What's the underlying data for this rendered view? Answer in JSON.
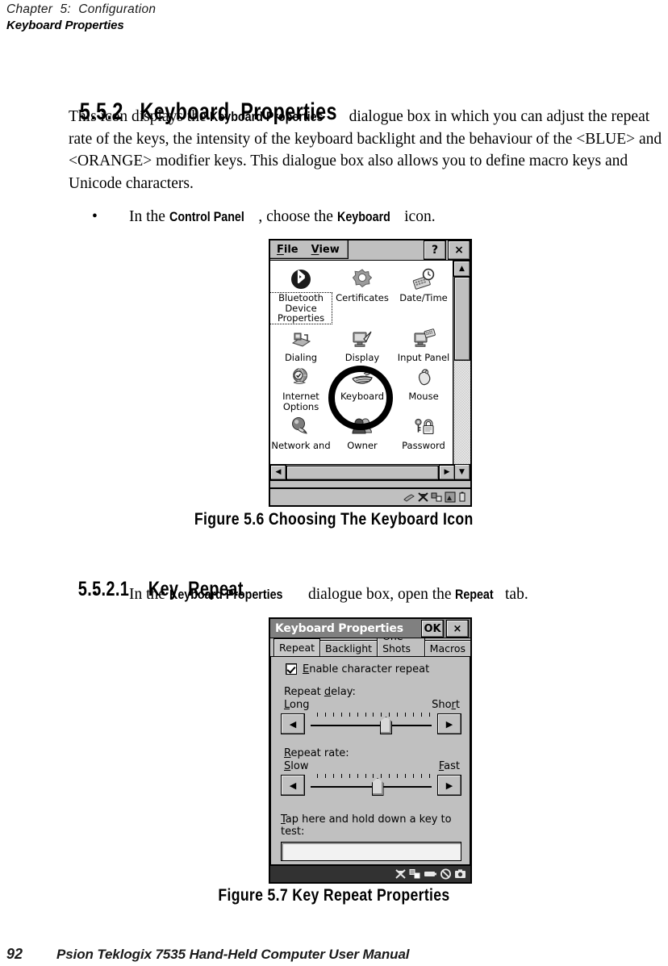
{
  "running_head": {
    "chapter": "Chapter  5:  Configuration",
    "topic": "Keyboard Properties"
  },
  "sections": {
    "s552_number": "5.5.2",
    "s552_title": "Keyboard  Properties",
    "s5521_number": "5.5.2.1",
    "s5521_title": "Key  Repeat"
  },
  "body": {
    "p1_a": "This icon displays the ",
    "p1_ui1": "Keyboard  Properties",
    "p1_b": " dialogue box in which you can adjust the repeat rate of the keys, the intensity of the keyboard backlight and the behaviour of the <BLUE> and <ORANGE> modifier keys. This dialogue box also allows you to define macro keys and Unicode characters.",
    "bullet1_dot": "•",
    "bullet1_a": "In the ",
    "bullet1_ui": "Control  Panel",
    "bullet1_b": ", choose the ",
    "bullet1_ui2": "Keyboard",
    "bullet1_c": " icon.",
    "bullet2_dot": "•",
    "bullet2_a": "In the ",
    "bullet2_ui": "Keyboard  Properties",
    "bullet2_b": " dialogue box, open the ",
    "bullet2_ui2": "Repeat",
    "bullet2_c": " tab."
  },
  "figures": {
    "fig56": "Figure  5.6  Choosing  The  Keyboard  Icon",
    "fig57": "Figure  5.7  Key  Repeat  Properties"
  },
  "footer": {
    "page_number": "92",
    "manual_title": "Psion Teklogix 7535 Hand-Held Computer User Manual"
  },
  "control_panel": {
    "menus": [
      {
        "pre": "",
        "accel": "F",
        "post": "ile"
      },
      {
        "pre": "",
        "accel": "V",
        "post": "iew"
      }
    ],
    "help_button": "?",
    "close_button": "×",
    "scroll_left": "◀",
    "scroll_right": "▶",
    "scroll_up": "▲",
    "scroll_down": "▼",
    "icons": [
      {
        "label": "Bluetooth Device Properties",
        "icon": "bluetooth-icon",
        "selected": true
      },
      {
        "label": "Certificates",
        "icon": "certificates-icon",
        "selected": false
      },
      {
        "label": "Date/Time",
        "icon": "date-time-icon",
        "selected": false
      },
      {
        "label": "Dialing",
        "icon": "dialing-icon",
        "selected": false
      },
      {
        "label": "Display",
        "icon": "display-icon",
        "selected": false
      },
      {
        "label": "Input Panel",
        "icon": "input-panel-icon",
        "selected": false
      },
      {
        "label": "Internet Options",
        "icon": "internet-options-icon",
        "selected": false
      },
      {
        "label": "Keyboard",
        "icon": "keyboard-icon",
        "selected": false
      },
      {
        "label": "Mouse",
        "icon": "mouse-icon",
        "selected": false
      },
      {
        "label": "Network and",
        "icon": "network-icon",
        "selected": false
      },
      {
        "label": "Owner",
        "icon": "owner-icon",
        "selected": false
      },
      {
        "label": "Password",
        "icon": "password-icon",
        "selected": false
      }
    ],
    "tray_icons": [
      "stylus-icon",
      "no-signal-icon",
      "connection-icon",
      "signal-icon",
      "battery-icon"
    ]
  },
  "keyboard_properties": {
    "title": "Keyboard Properties",
    "ok_button": "OK",
    "close_button": "×",
    "tabs": [
      {
        "label": "Repeat",
        "active": true
      },
      {
        "label": "Backlight",
        "active": false
      },
      {
        "label": "One Shots",
        "active": false
      },
      {
        "label": "Macros",
        "active": false
      }
    ],
    "enable_repeat": {
      "accel": "E",
      "rest": "nable character repeat",
      "checked": true
    },
    "repeat_delay": {
      "label_pre": "Repeat ",
      "label_accel": "d",
      "label_post": "elay:",
      "left_accel": "L",
      "left_rest": "ong",
      "right_pre": "Sho",
      "right_accel": "r",
      "right_post": "t",
      "value_percent": 62,
      "tick_count": 15,
      "left_button": "◀",
      "right_button": "▶"
    },
    "repeat_rate": {
      "label_accel": "R",
      "label_post": "epeat rate:",
      "left_accel": "S",
      "left_rest": "low",
      "right_accel": "F",
      "right_rest": "ast",
      "value_percent": 55,
      "tick_count": 15,
      "left_button": "◀",
      "right_button": "▶"
    },
    "test_field": {
      "label_accel": "T",
      "label_rest": "ap here and hold down a key to test:",
      "value": ""
    },
    "tray_icons": [
      "no-signal-icon",
      "connection-icon",
      "battery-icon",
      "prohibited-icon",
      "camera-icon"
    ]
  },
  "colors": {
    "window_face": "#c0c0c0",
    "title_bar": "#808080",
    "dark_taskbar": "#323232",
    "text": "#000000"
  }
}
